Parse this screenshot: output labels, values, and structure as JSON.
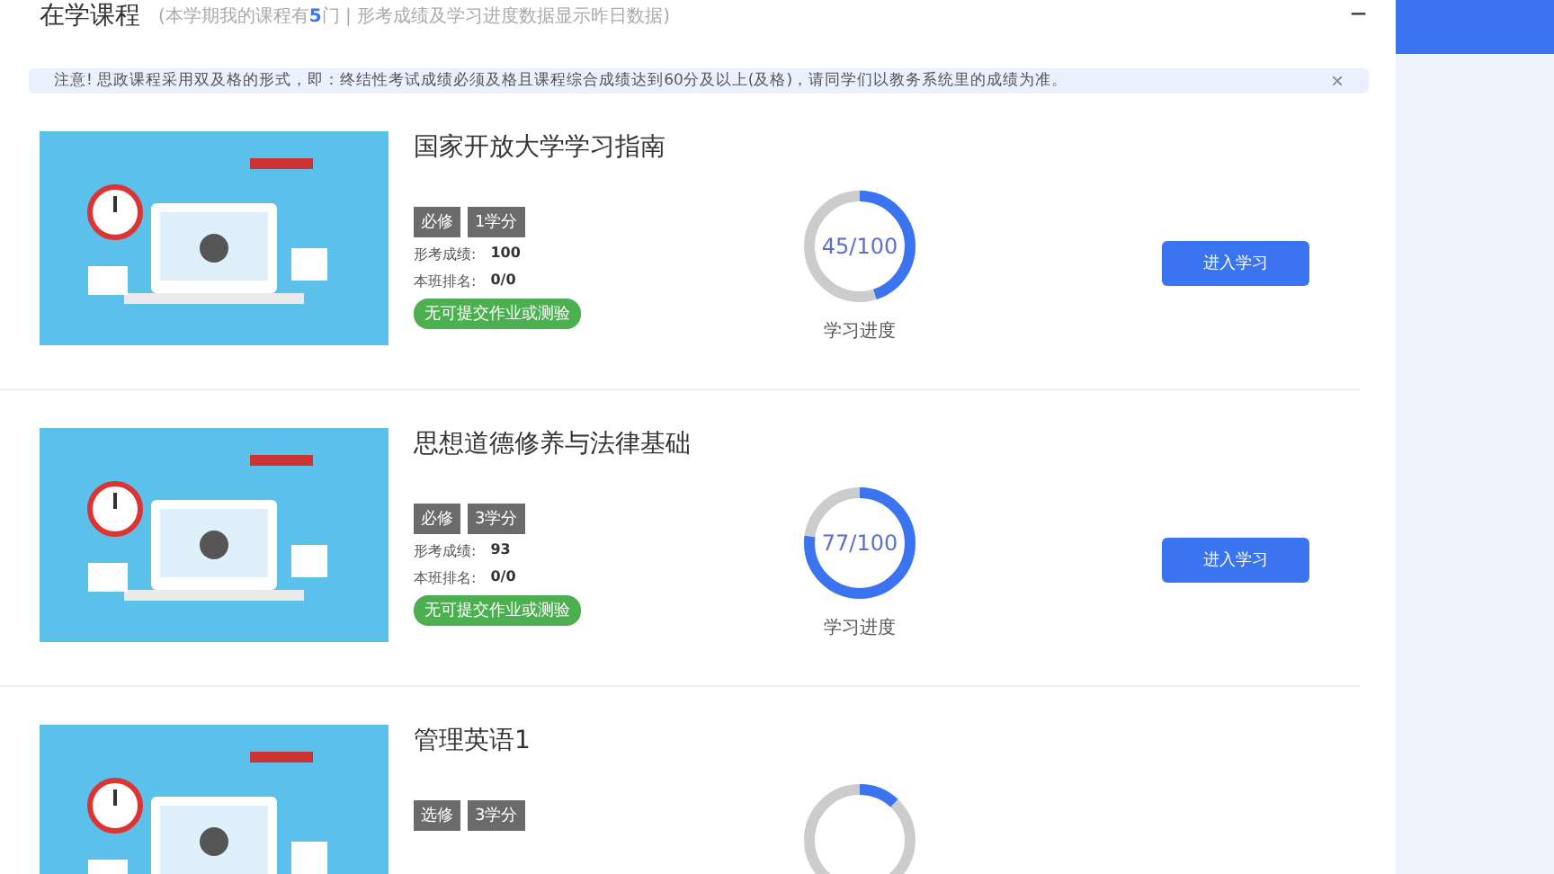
{
  "header": {
    "title": "在学课程",
    "note": "(本学期我的课程有**5**门 | 形考成绩及学习进度数据显示昨日数据)",
    "collapse": "−"
  },
  "notice": {
    "text": "注意! 思政课程采用双及格的形式，即：终结性考试成绩必须及格且课程综合成绩达到60分及以上(及格)，请同学们以教务系统里的成绩为准。",
    "close": "×"
  },
  "courses": [
    {
      "title": "国家开放大学学习指南",
      "tags": [
        "必修",
        "1学分"
      ],
      "grade_label": "形考成绩:",
      "grade": "100",
      "rank_label": "本班排名:",
      "rank": "0/0",
      "status": "无可提交作业或测验",
      "level": 0.45,
      "progress": "45/100",
      "progress_label": "学习进度",
      "button": "进入学习"
    },
    {
      "title": "思想道德修养与法律基础",
      "tags": [
        "必修",
        "3学分"
      ],
      "grade_label": "形考成绩:",
      "grade": "93",
      "rank_label": "本班排名:",
      "rank": "0/0",
      "status": "无可提交作业或测验",
      "level": 0.77,
      "progress": "77/100",
      "progress_label": "学习进度",
      "button": "进入学习"
    },
    {
      "title": "管理英语1",
      "tags": [
        "选修",
        "3学分"
      ],
      "level": 0.12
    }
  ]
}
